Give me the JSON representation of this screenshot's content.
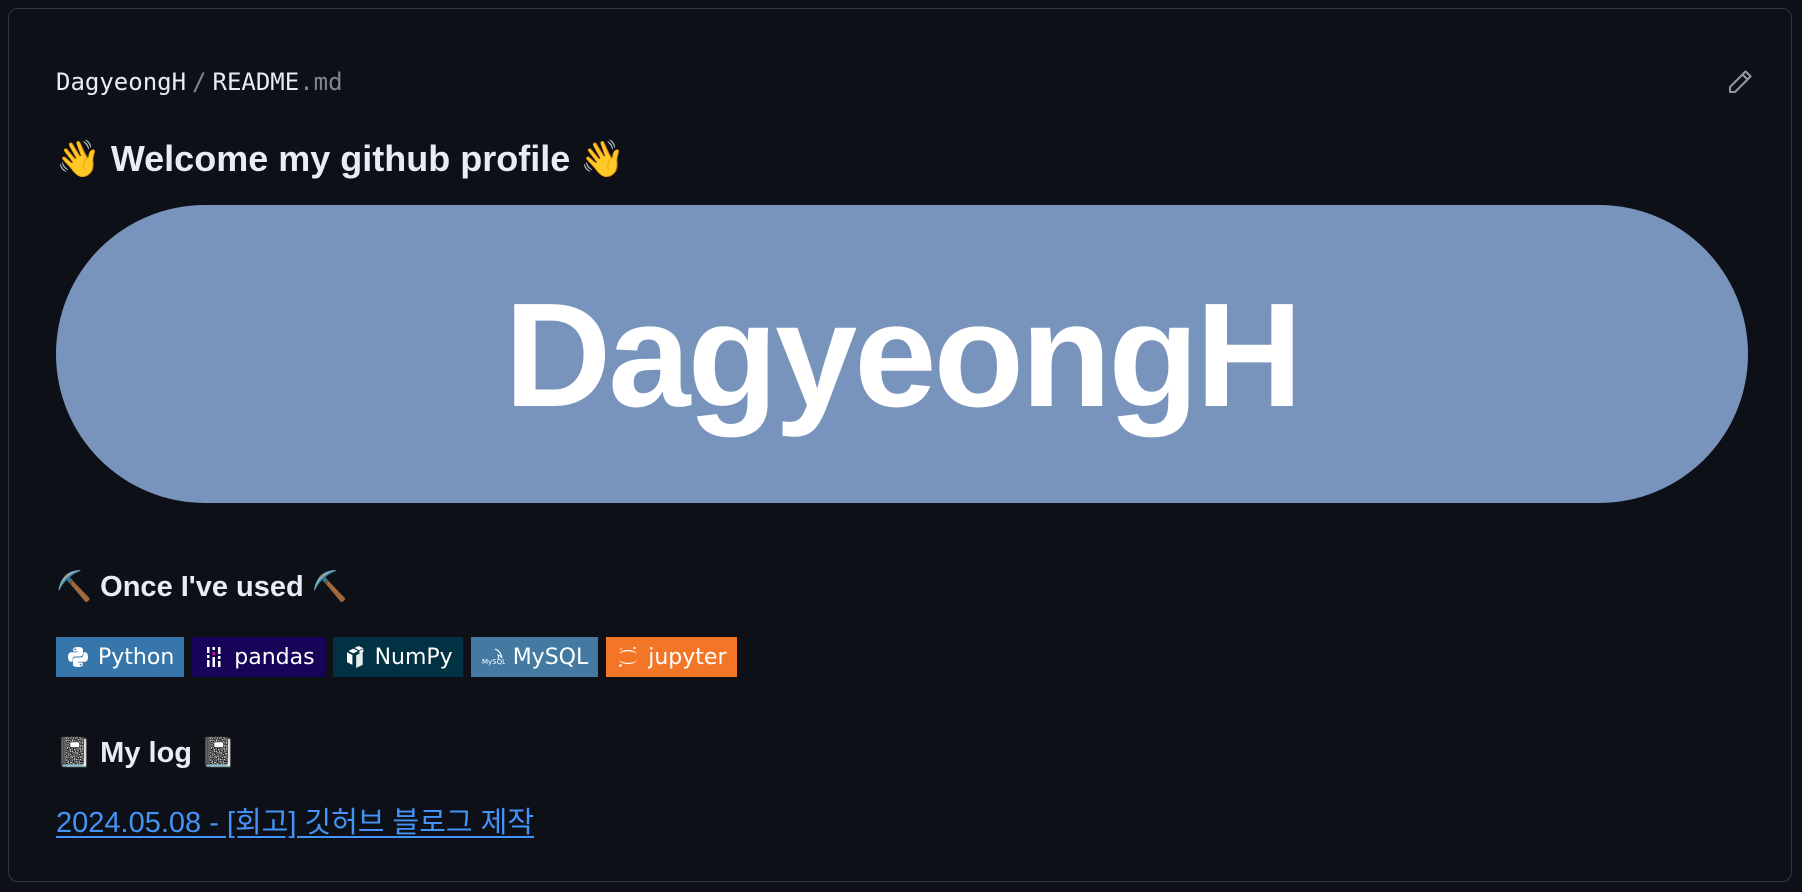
{
  "file_header": {
    "user": "DagyeongH",
    "separator": "/",
    "filename": "README",
    "extension": ".md",
    "edit_icon": "pencil-icon"
  },
  "readme": {
    "welcome_heading": "👋 Welcome my github profile 👋",
    "banner_text": "DagyeongH",
    "banner_color": "#7994bc",
    "tools_heading": "⛏️ Once I've used ⛏️",
    "badges": [
      {
        "label": "Python",
        "icon": "python-icon",
        "color": "#3776ab"
      },
      {
        "label": "pandas",
        "icon": "pandas-icon",
        "color": "#150458"
      },
      {
        "label": "NumPy",
        "icon": "numpy-icon",
        "color": "#013243"
      },
      {
        "label": "MySQL",
        "icon": "mysql-icon",
        "color": "#4479a1"
      },
      {
        "label": "jupyter",
        "icon": "jupyter-icon",
        "color": "#f37626"
      }
    ],
    "log_heading": "📓 My log 📓",
    "log_link": "2024.05.08 - [회고] 깃허브 블로그 제작"
  },
  "colors": {
    "background": "#0d1117",
    "border": "#30363d",
    "link": "#4493f8"
  }
}
